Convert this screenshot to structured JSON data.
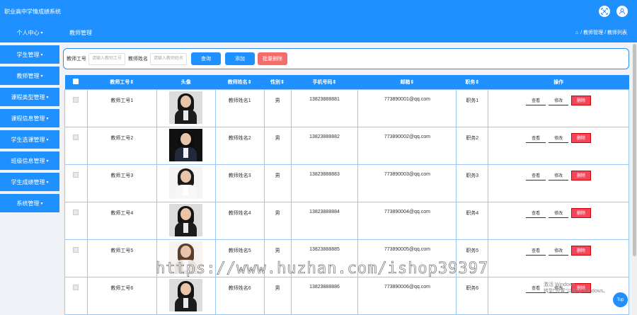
{
  "app": {
    "title": "职业高中学情成绩系统",
    "colors": {
      "primary": "#1e90ff",
      "danger": "#f56c6c"
    },
    "icons": [
      "fullscreen-icon",
      "user-icon"
    ]
  },
  "sidebar": {
    "top_item": "个人中心",
    "items": [
      {
        "label": "学生管理"
      },
      {
        "label": "教师管理"
      },
      {
        "label": "课程类型管理"
      },
      {
        "label": "课程信息管理"
      },
      {
        "label": "学生选课管理"
      },
      {
        "label": "班级信息管理"
      },
      {
        "label": "学生成绩管理"
      },
      {
        "label": "系统管理"
      }
    ]
  },
  "header": {
    "page_title": "教师管理",
    "breadcrumb": "/ 教师管理 / 教师列表"
  },
  "search": {
    "field1_label": "教师工号",
    "field1_placeholder": "请输入教师工号",
    "field2_label": "教师姓名",
    "field2_placeholder": "请输入教师姓名",
    "search_btn": "查询",
    "add_btn": "添加",
    "batch_delete_btn": "批量删除"
  },
  "table": {
    "columns": [
      "教师工号⇕",
      "头像",
      "教师姓名⇕",
      "性别⇕",
      "手机号码⇕",
      "邮箱⇕",
      "职务⇕",
      "操作"
    ],
    "actions": {
      "view": "查看",
      "edit": "修改",
      "delete": "删除"
    },
    "rows": [
      {
        "id": "教师工号1",
        "name": "教师姓名1",
        "gender": "男",
        "phone": "13823888881",
        "email": "773890001@qq.com",
        "title": "职务1",
        "avatar": "woman-dark-suit"
      },
      {
        "id": "教师工号2",
        "name": "教师姓名2",
        "gender": "男",
        "phone": "13823888882",
        "email": "773890002@qq.com",
        "title": "职务2",
        "avatar": "man-suit"
      },
      {
        "id": "教师工号3",
        "name": "教师姓名3",
        "gender": "男",
        "phone": "13823888883",
        "email": "773890003@qq.com",
        "title": "职务3",
        "avatar": "woman-white-top"
      },
      {
        "id": "教师工号4",
        "name": "教师姓名4",
        "gender": "男",
        "phone": "13823888884",
        "email": "773890004@qq.com",
        "title": "职务4",
        "avatar": "woman-dark-suit"
      },
      {
        "id": "教师工号5",
        "name": "教师姓名5",
        "gender": "男",
        "phone": "13823888885",
        "email": "773890005@qq.com",
        "title": "职务5",
        "avatar": "woman-light"
      },
      {
        "id": "教师工号6",
        "name": "教师姓名6",
        "gender": "男",
        "phone": "13823888886",
        "email": "773890006@qq.com",
        "title": "职务6",
        "avatar": "woman-dark-suit"
      }
    ]
  },
  "overlay": {
    "watermark": "https://www.huzhan.com/ishop39397",
    "activate_line1": "激活 Windows",
    "activate_line2": "转到\"设置\"以激活 Windows。",
    "top_btn": "Top"
  }
}
